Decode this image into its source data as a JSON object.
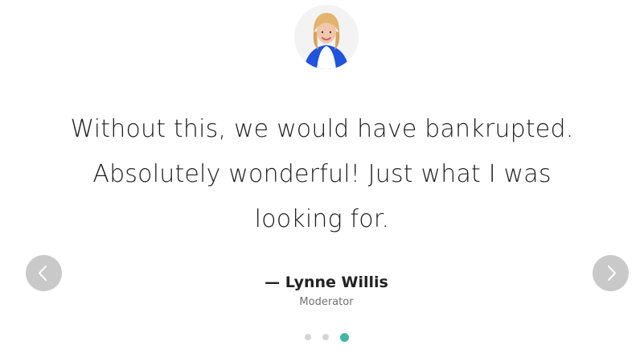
{
  "testimonial": {
    "quote": "Without this, we would have bankrupted. Absolutely wonderful! Just what I was looking for.",
    "author": "— Lynne Willis",
    "role": "Moderator"
  },
  "carousel": {
    "active_index": 3,
    "dot_count": 3,
    "accent_color": "#3fb7a5",
    "inactive_color": "#d5d5d5",
    "nav_color": "#c9c9c9"
  },
  "icons": {
    "prev": "chevron-left-icon",
    "next": "chevron-right-icon"
  }
}
